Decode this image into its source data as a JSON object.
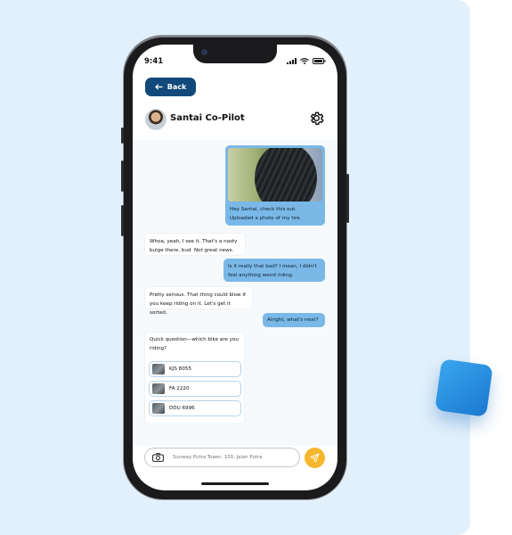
{
  "status": {
    "time": "9:41"
  },
  "nav": {
    "back_label": "Back"
  },
  "header": {
    "title": "Santai Co-Pilot"
  },
  "messages": [
    {
      "sender": "user",
      "text_line1": "Hey Santai, check this out.",
      "text_line2": "Uploaded a photo of my tire."
    },
    {
      "sender": "bot",
      "text_line1": "Whoa, yeah, I see it. That's a nasty",
      "text_line2": "bulge there, bud. Not great news."
    },
    {
      "sender": "user",
      "text_line1": "Is it really that bad? I mean, I didn't",
      "text_line2": "feel anything weird riding."
    },
    {
      "sender": "bot",
      "text_line1": "Pretty serious. That thing could blow if",
      "text_line2": "you keep riding on it. Let's get it sorted."
    },
    {
      "sender": "user",
      "text_line1": "Alright, what's next?"
    },
    {
      "sender": "bot",
      "text_line1": "Quick question—which bike are you",
      "text_line2": "riding?"
    }
  ],
  "bike_options": [
    {
      "plate": "KJS 8055"
    },
    {
      "plate": "FA 2220"
    },
    {
      "plate": "DDU 6996"
    }
  ],
  "composer": {
    "placeholder": "Sunway Putra Tower, 100, Jalan Putra"
  },
  "icons": {
    "back": "arrow-left-icon",
    "settings": "gear-icon",
    "camera": "camera-icon",
    "send": "send-icon"
  },
  "colors": {
    "primary": "#10497a",
    "user_bubble": "#7ab9e7",
    "send_button": "#f7b72c",
    "background": "#e2f0fb"
  }
}
